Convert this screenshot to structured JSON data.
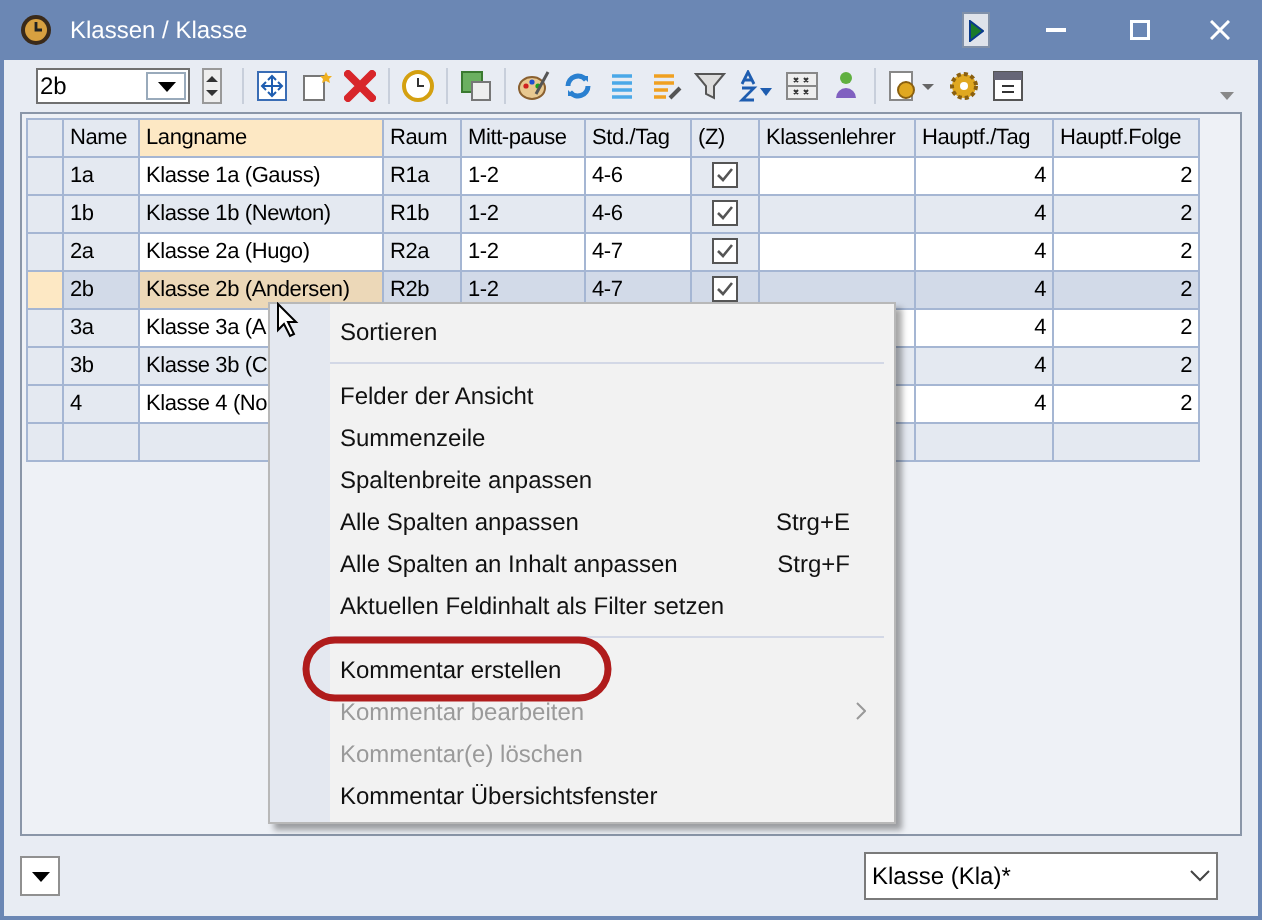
{
  "window": {
    "title": "Klassen / Klasse"
  },
  "toolbar": {
    "class_selector": {
      "value": "2b"
    }
  },
  "grid": {
    "columns": [
      {
        "label": "Name",
        "selected": false
      },
      {
        "label": "Langname",
        "selected": true
      },
      {
        "label": "Raum",
        "selected": false
      },
      {
        "label": "Mitt-pause",
        "selected": false
      },
      {
        "label": "Std./Tag",
        "selected": false
      },
      {
        "label": "(Z)",
        "selected": false
      },
      {
        "label": "Klassenlehrer",
        "selected": false
      },
      {
        "label": "Hauptf./Tag",
        "selected": false
      },
      {
        "label": "Hauptf.Folge",
        "selected": false
      }
    ],
    "rows": [
      {
        "selected": false,
        "name": "1a",
        "long_name": "Klasse 1a (Gauss)",
        "room": "R1a",
        "lunch_break": "1-2",
        "hours_per_day": "4-6",
        "z_checked": true,
        "main_per_day": "4",
        "main_sequence": "2"
      },
      {
        "selected": false,
        "name": "1b",
        "long_name": "Klasse 1b (Newton)",
        "room": "R1b",
        "lunch_break": "1-2",
        "hours_per_day": "4-6",
        "z_checked": true,
        "main_per_day": "4",
        "main_sequence": "2"
      },
      {
        "selected": false,
        "name": "2a",
        "long_name": "Klasse 2a (Hugo)",
        "room": "R2a",
        "lunch_break": "1-2",
        "hours_per_day": "4-7",
        "z_checked": true,
        "main_per_day": "4",
        "main_sequence": "2"
      },
      {
        "selected": true,
        "name": "2b",
        "long_name": "Klasse 2b (Andersen)",
        "room": "R2b",
        "lunch_break": "1-2",
        "hours_per_day": "4-7",
        "z_checked": true,
        "main_per_day": "4",
        "main_sequence": "2"
      },
      {
        "selected": false,
        "name": "3a",
        "long_name": "Klasse 3a (A",
        "main_per_day": "4",
        "main_sequence": "2"
      },
      {
        "selected": false,
        "name": "3b",
        "long_name": "Klasse 3b (C",
        "main_per_day": "4",
        "main_sequence": "2"
      },
      {
        "selected": false,
        "name": "4",
        "long_name": "Klasse 4 (No",
        "main_per_day": "4",
        "main_sequence": "2"
      }
    ]
  },
  "context_menu": {
    "items": [
      {
        "kind": "item",
        "label": "Sortieren",
        "disabled": false
      },
      {
        "kind": "separator"
      },
      {
        "kind": "item",
        "label": "Felder der Ansicht",
        "disabled": false
      },
      {
        "kind": "item",
        "label": "Summenzeile",
        "disabled": false
      },
      {
        "kind": "item",
        "label": "Spaltenbreite anpassen",
        "disabled": false
      },
      {
        "kind": "item",
        "label": "Alle Spalten anpassen",
        "shortcut": "Strg+E",
        "disabled": false
      },
      {
        "kind": "item",
        "label": "Alle Spalten an Inhalt anpassen",
        "shortcut": "Strg+F",
        "disabled": false
      },
      {
        "kind": "item",
        "label": "Aktuellen Feldinhalt als Filter setzen",
        "disabled": false
      },
      {
        "kind": "separator"
      },
      {
        "kind": "item",
        "label": "Kommentar erstellen",
        "disabled": false,
        "highlighted": true
      },
      {
        "kind": "item",
        "label": "Kommentar bearbeiten",
        "disabled": true,
        "submenu": true
      },
      {
        "kind": "item",
        "label": "Kommentar(e) löschen",
        "disabled": true
      },
      {
        "kind": "item",
        "label": "Kommentar Übersichtsfenster",
        "disabled": false
      }
    ]
  },
  "footer": {
    "view_selector": {
      "value": "Klasse (Kla)*"
    }
  }
}
